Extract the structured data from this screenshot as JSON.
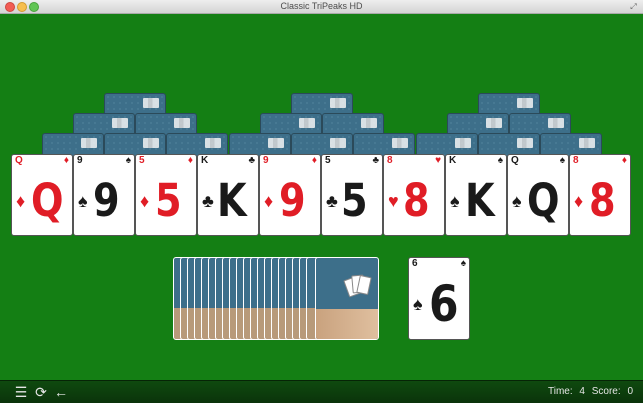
{
  "window": {
    "title": "Classic TriPeaks HD"
  },
  "board": {
    "bottom_row": [
      {
        "rank": "Q",
        "suit": "♦",
        "color": "red"
      },
      {
        "rank": "9",
        "suit": "♠",
        "color": "black"
      },
      {
        "rank": "5",
        "suit": "♦",
        "color": "red"
      },
      {
        "rank": "K",
        "suit": "♣",
        "color": "black"
      },
      {
        "rank": "9",
        "suit": "♦",
        "color": "red"
      },
      {
        "rank": "5",
        "suit": "♣",
        "color": "black"
      },
      {
        "rank": "8",
        "suit": "♥",
        "color": "red"
      },
      {
        "rank": "K",
        "suit": "♠",
        "color": "black"
      },
      {
        "rank": "Q",
        "suit": "♠",
        "color": "black"
      },
      {
        "rank": "8",
        "suit": "♦",
        "color": "red"
      }
    ],
    "waste_card": {
      "rank": "6",
      "suit": "♠",
      "color": "black"
    }
  },
  "status": {
    "time_label": "Time:",
    "time_value": "4",
    "score_label": "Score:",
    "score_value": "0"
  },
  "icons": {
    "menu": "menu-icon",
    "restart": "restart-icon",
    "undo": "undo-arrow-icon"
  },
  "colors": {
    "felt": "#147f14",
    "card_back": "#3d6f8a",
    "red_suit": "#e01d26"
  }
}
